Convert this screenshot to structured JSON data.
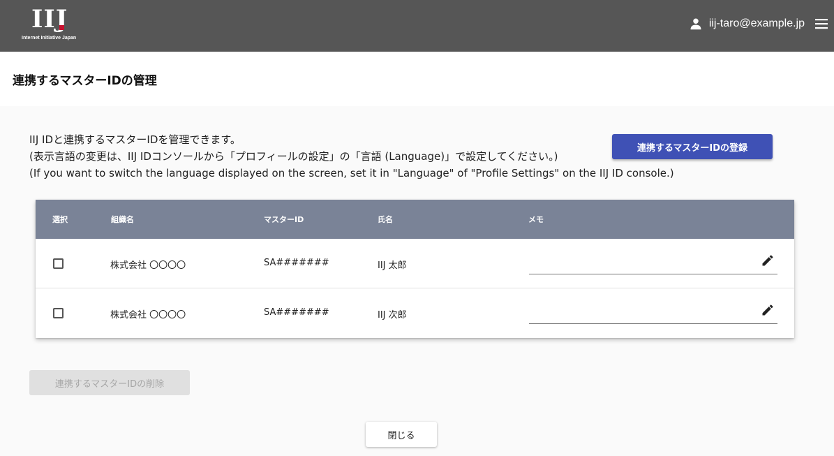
{
  "header": {
    "logo_text": "IIJ",
    "logo_subtext": "Internet Initiative Japan",
    "user_icon": "person-icon",
    "user_email": "iij-taro@example.jp",
    "menu_icon": "hamburger-menu-icon"
  },
  "page": {
    "title": "連携するマスターIDの管理"
  },
  "description": {
    "line1": "IIJ IDと連携するマスターIDを管理できます。",
    "line2": "(表示言語の変更は、IIJ IDコンソールから「プロフィールの設定」の「言語 (Language)」で設定してください。)",
    "line3": "(If you want to switch the language displayed on the screen, set it in \"Language\" of \"Profile Settings\" on the IIJ ID console.)"
  },
  "buttons": {
    "register": "連携するマスターIDの登録",
    "delete": "連携するマスターIDの削除",
    "close": "閉じる"
  },
  "table": {
    "headers": {
      "select": "選択",
      "org": "組織名",
      "master_id": "マスターID",
      "name": "氏名",
      "memo": "メモ"
    },
    "rows": [
      {
        "org": "株式会社 〇〇〇〇",
        "master_id": "SA#######",
        "name": "IIJ 太郎",
        "memo": ""
      },
      {
        "org": "株式会社 〇〇〇〇",
        "master_id": "SA#######",
        "name": "IIJ 次郎",
        "memo": ""
      }
    ]
  },
  "colors": {
    "topbar": "#565656",
    "primary": "#3f51b5",
    "table_header": "#7a8397",
    "logo_accent": "#c8102e"
  }
}
